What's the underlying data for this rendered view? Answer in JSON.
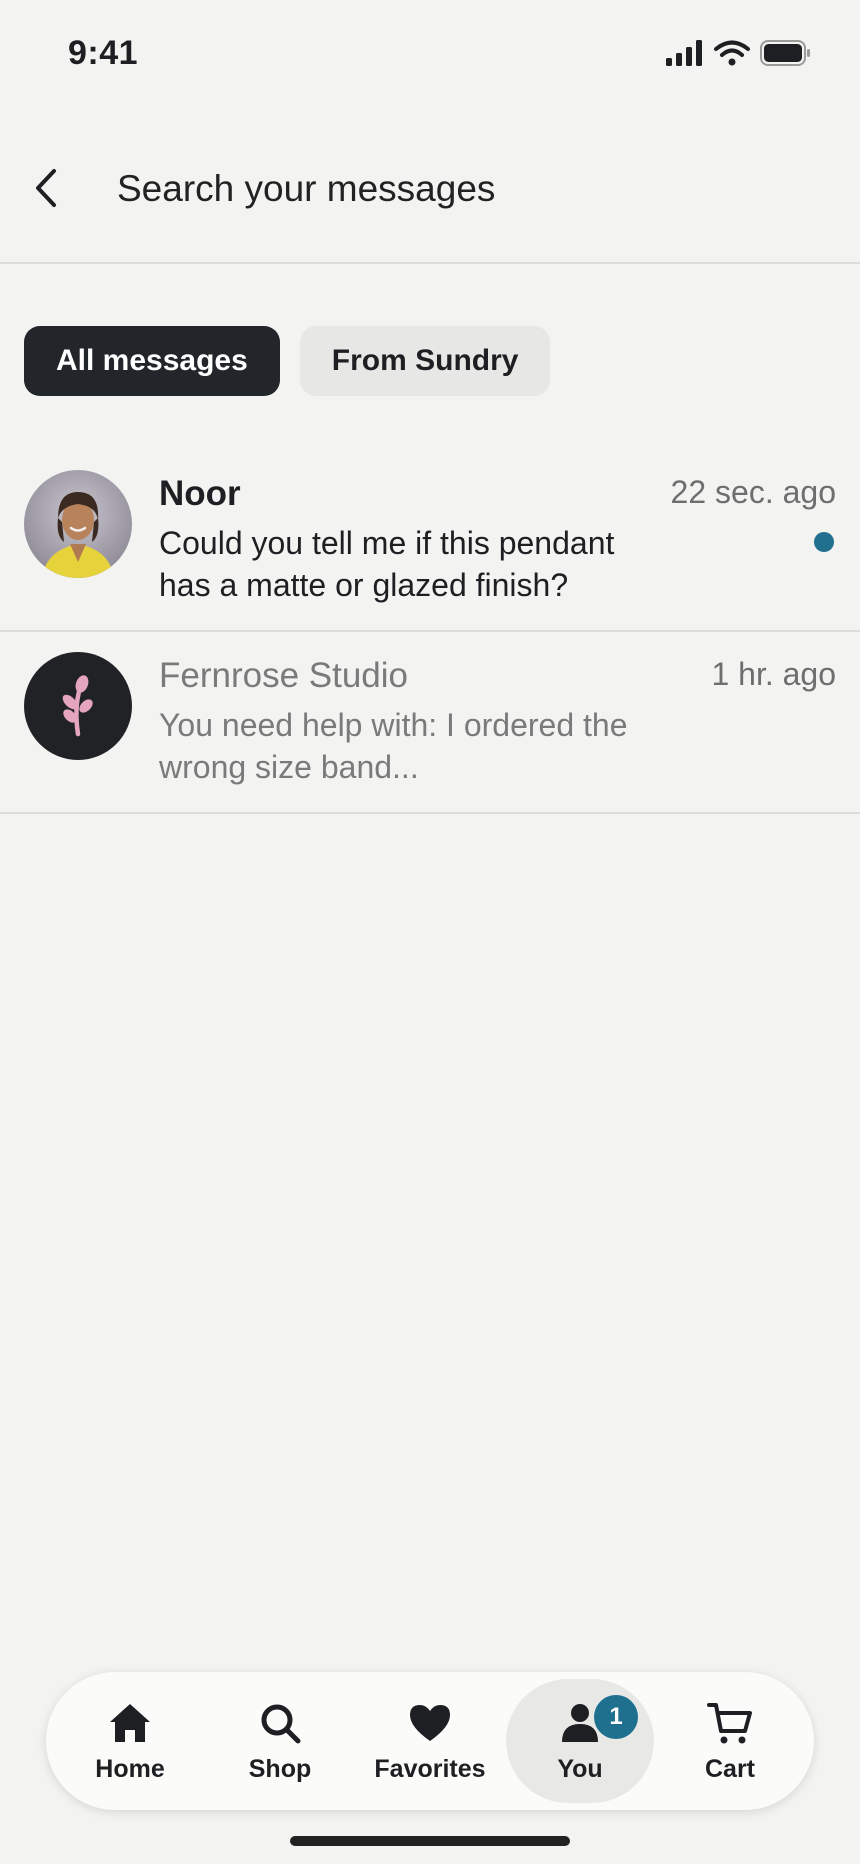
{
  "status_bar": {
    "time": "9:41",
    "icons": [
      "signal-icon",
      "wifi-icon",
      "battery-icon"
    ]
  },
  "header": {
    "back_icon": "chevron-left-icon",
    "search_placeholder": "Search your messages"
  },
  "filters": {
    "active": "All messages",
    "items": [
      {
        "label": "All messages",
        "selected": true
      },
      {
        "label": "From Sundry",
        "selected": false
      }
    ]
  },
  "messages": [
    {
      "name": "Noor",
      "time": "22 sec. ago",
      "body": "Could you tell me if this pendant has a matte or glazed finish?",
      "unread": true,
      "avatar": "person-photo"
    },
    {
      "name": "Fernrose Studio",
      "time": "1 hr. ago",
      "body": "You need help with: I ordered the wrong size band...",
      "unread": false,
      "avatar": "sprout-logo-icon"
    }
  ],
  "nav": {
    "items": [
      {
        "label": "Home",
        "icon": "home-icon"
      },
      {
        "label": "Shop",
        "icon": "search-icon"
      },
      {
        "label": "Favorites",
        "icon": "heart-icon"
      },
      {
        "label": "You",
        "icon": "person-icon",
        "badge": "1",
        "active": true
      },
      {
        "label": "Cart",
        "icon": "cart-icon"
      }
    ]
  },
  "colors": {
    "background": "#f3f3f1",
    "chip_active": "#22262b",
    "unread_dot": "#21708f",
    "badge": "#1f6f8e"
  }
}
